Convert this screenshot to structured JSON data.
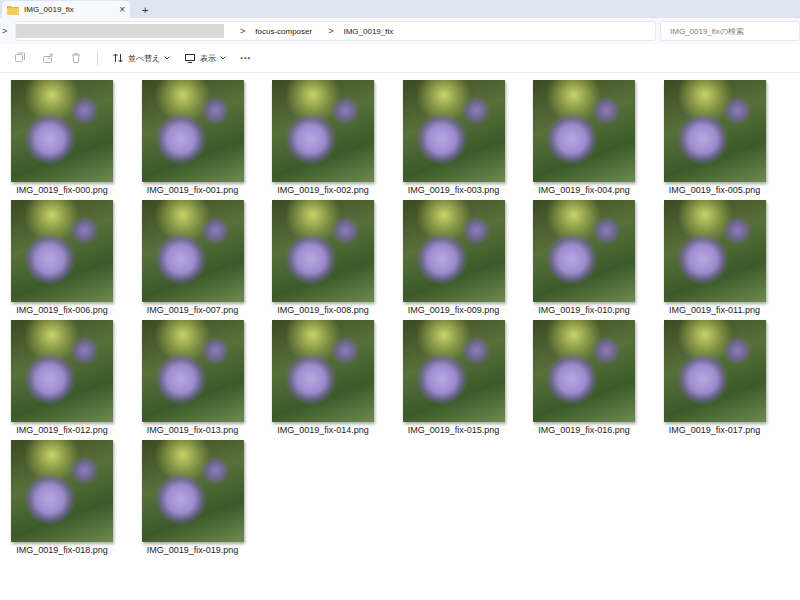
{
  "window": {
    "title": "IMG_0019_fix"
  },
  "tab": {
    "label": "IMG_0019_fix",
    "close": "×",
    "selected": true
  },
  "new_tab": "+",
  "address": {
    "expander": ">",
    "separator": ">",
    "crumbs": [
      "focus-composer",
      "IMG_0019_fix"
    ]
  },
  "search": {
    "placeholder": "IMG_0019_fixの検索"
  },
  "toolbar": {
    "icon_actions": [
      {
        "disabled": true
      },
      {
        "disabled": true
      },
      {
        "disabled": true
      }
    ],
    "buttons": [
      {
        "label": "並べ替え"
      },
      {
        "label": "表示"
      }
    ],
    "more": "···"
  },
  "files": [
    {
      "name": "IMG_0019_fix-000.png"
    },
    {
      "name": "IMG_0019_fix-001.png"
    },
    {
      "name": "IMG_0019_fix-002.png"
    },
    {
      "name": "IMG_0019_fix-003.png"
    },
    {
      "name": "IMG_0019_fix-004.png"
    },
    {
      "name": "IMG_0019_fix-005.png"
    },
    {
      "name": "IMG_0019_fix-006.png"
    },
    {
      "name": "IMG_0019_fix-007.png"
    },
    {
      "name": "IMG_0019_fix-008.png"
    },
    {
      "name": "IMG_0019_fix-009.png"
    },
    {
      "name": "IMG_0019_fix-010.png"
    },
    {
      "name": "IMG_0019_fix-011.png"
    },
    {
      "name": "IMG_0019_fix-012.png"
    },
    {
      "name": "IMG_0019_fix-013.png"
    },
    {
      "name": "IMG_0019_fix-014.png"
    },
    {
      "name": "IMG_0019_fix-015.png"
    },
    {
      "name": "IMG_0019_fix-016.png"
    },
    {
      "name": "IMG_0019_fix-017.png"
    },
    {
      "name": "IMG_0019_fix-018.png"
    },
    {
      "name": "IMG_0019_fix-019.png"
    }
  ]
}
